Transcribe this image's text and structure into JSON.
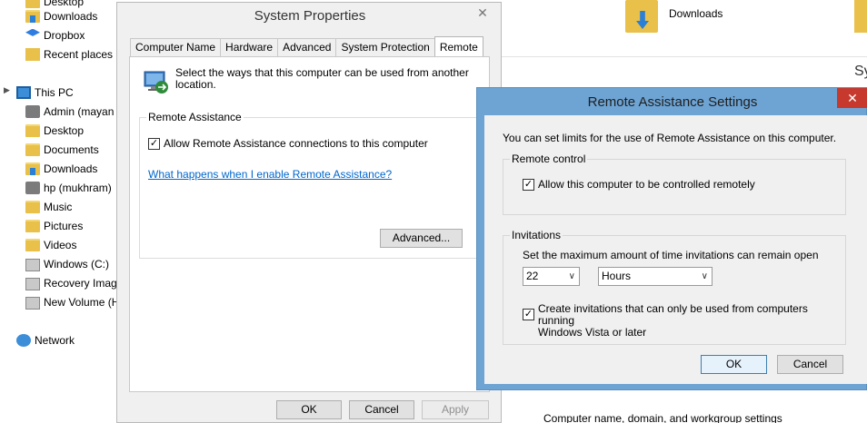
{
  "nav": {
    "items": [
      {
        "label": "Desktop",
        "icon": "folder-icon"
      },
      {
        "label": "Downloads",
        "icon": "downloads-folder-icon"
      },
      {
        "label": "Dropbox",
        "icon": "dropbox-icon"
      },
      {
        "label": "Recent places",
        "icon": "recent-places-icon"
      },
      {
        "label": "This PC",
        "icon": "computer-icon"
      },
      {
        "label": "Admin (mayan",
        "icon": "user-icon"
      },
      {
        "label": "Desktop",
        "icon": "folder-icon"
      },
      {
        "label": "Documents",
        "icon": "folder-icon"
      },
      {
        "label": "Downloads",
        "icon": "downloads-folder-icon"
      },
      {
        "label": "hp (mukhram)",
        "icon": "user-icon"
      },
      {
        "label": "Music",
        "icon": "folder-icon"
      },
      {
        "label": "Pictures",
        "icon": "folder-icon"
      },
      {
        "label": "Videos",
        "icon": "folder-icon"
      },
      {
        "label": "Windows (C:)",
        "icon": "drive-icon"
      },
      {
        "label": "Recovery Imag",
        "icon": "drive-icon"
      },
      {
        "label": "New Volume (H",
        "icon": "drive-icon"
      },
      {
        "label": "Network",
        "icon": "network-icon"
      }
    ]
  },
  "background": {
    "downloads_label": "Downloads",
    "right_heading_fragment": "Sy",
    "computer_name_heading": "Computer name, domain, and workgroup settings"
  },
  "system_properties": {
    "title": "System Properties",
    "close_glyph": "✕",
    "tabs": [
      "Computer Name",
      "Hardware",
      "Advanced",
      "System Protection",
      "Remote"
    ],
    "active_tab": "Remote",
    "intro": "Select the ways that this computer can be used from another location.",
    "remote_assistance_legend": "Remote Assistance",
    "allow_remote_assistance_label": "Allow Remote Assistance connections to this computer",
    "allow_remote_assistance_checked": true,
    "help_link": "What happens when I enable Remote Assistance?",
    "advanced_button": "Advanced...",
    "ok_button": "OK",
    "cancel_button": "Cancel",
    "apply_button": "Apply"
  },
  "remote_assistance_settings": {
    "title": "Remote Assistance Settings",
    "close_glyph": "✕",
    "intro": "You can set limits for the use of Remote Assistance on this computer.",
    "remote_control_legend": "Remote control",
    "allow_control_label": "Allow this computer to be controlled remotely",
    "allow_control_checked": true,
    "invitations_legend": "Invitations",
    "max_time_label": "Set the maximum amount of time invitations can remain open",
    "time_value": "22",
    "time_unit": "Hours",
    "vista_only_label_line1": "Create invitations that can only be used from computers running",
    "vista_only_label_line2": "Windows Vista or later",
    "vista_only_checked": true,
    "ok_button": "OK",
    "cancel_button": "Cancel"
  },
  "colors": {
    "dialog_frame": "#6ea4d4",
    "close_red": "#c7382d",
    "link": "#0066cc"
  }
}
